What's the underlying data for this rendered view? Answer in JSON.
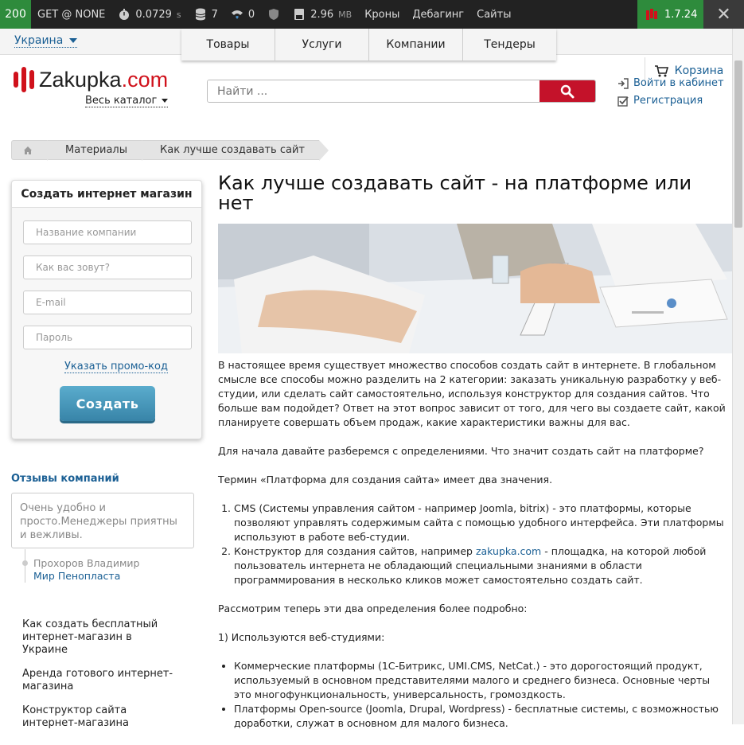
{
  "debug": {
    "status": "200",
    "method": "GET @ NONE",
    "time": "0.0729",
    "time_unit": "s",
    "db": "7",
    "net": "0",
    "shield": "",
    "memory": "2.96",
    "memory_unit": "MB",
    "menu": [
      "Кроны",
      "Дебагинг",
      "Сайты"
    ],
    "version": "1.7.24",
    "close": "✕"
  },
  "topnav": {
    "country": "Украина",
    "tabs": [
      "Товары",
      "Услуги",
      "Компании",
      "Тендеры"
    ],
    "cart": "Корзина"
  },
  "header": {
    "logo_main": "Zakupka",
    "logo_domain": ".com",
    "catalog": "Весь каталог",
    "search_placeholder": "Найти ...",
    "login": "Войти в кабинет",
    "register": "Регистрация"
  },
  "breadcrumb": [
    "Материалы",
    "Как лучше создавать сайт"
  ],
  "regbox": {
    "title": "Создать интернет магазин",
    "fields": [
      "Название компании",
      "Как вас зовут?",
      "E-mail",
      "Пароль"
    ],
    "promo": "Указать промо-код",
    "button": "Создать"
  },
  "reviews": {
    "title": "Отзывы компаний",
    "text": "Очень удобно и просто.Менеджеры приятны и вежливы.",
    "author": "Прохоров Владимир",
    "company": "Мир Пенопласта"
  },
  "side_links": [
    "Как создать бесплатный интернет-магазин в Украине",
    "Аренда готового интернет-магазина",
    "Конструктор сайта интернет-магазина"
  ],
  "article": {
    "title": "Как лучше создавать сайт - на платформе или нет",
    "p1": "В настоящее время существует множество способов создать сайт в интернете. В глобальном смысле все способы можно разделить на 2 категории: заказать уникальную разработку у веб-студии, или сделать сайт самостоятельно, используя конструктор для создания сайтов. Что больше вам подойдет? Ответ на этот вопрос зависит от того, для чего вы создаете сайт, какой планируете совершать объем продаж, какие характеристики важны для вас.",
    "p2": "Для начала давайте разберемся с определениями. Что значит создать сайт на платформе?",
    "p3": "Термин «Платформа для создания сайта» имеет два значения.",
    "ol1": "CMS (Системы управления сайтом - например Joomla, bitrix) - это платформы, которые позволяют управлять содержимым сайта с помощью удобного интерфейса. Эти платформы используют в работе веб-студии.",
    "ol2_pre": "Конструктор для создания сайтов, например ",
    "ol2_link": "zakupka.com",
    "ol2_post": " - площадка, на которой любой пользователь интернета не обладающий специальными знаниями в области программирования в несколько кликов может самостоятельно создать сайт.",
    "p4": "Рассмотрим теперь эти два определения более подробно:",
    "p5": "1) Используются веб-студиями:",
    "ul1": "Коммерческие платформы (1С-Битрикс, UMI.CMS, NetCat.) - это дорогостоящий продукт, используемый в основном представителями малого и среднего бизнеса. Основные черты это многофункциональность, универсальность, громоздкость.",
    "ul2": "Платформы Open-source (Joomla, Drupal, Wordpress) - бесплатные системы, с возможностью доработки, служат в основном для малого бизнеса."
  }
}
